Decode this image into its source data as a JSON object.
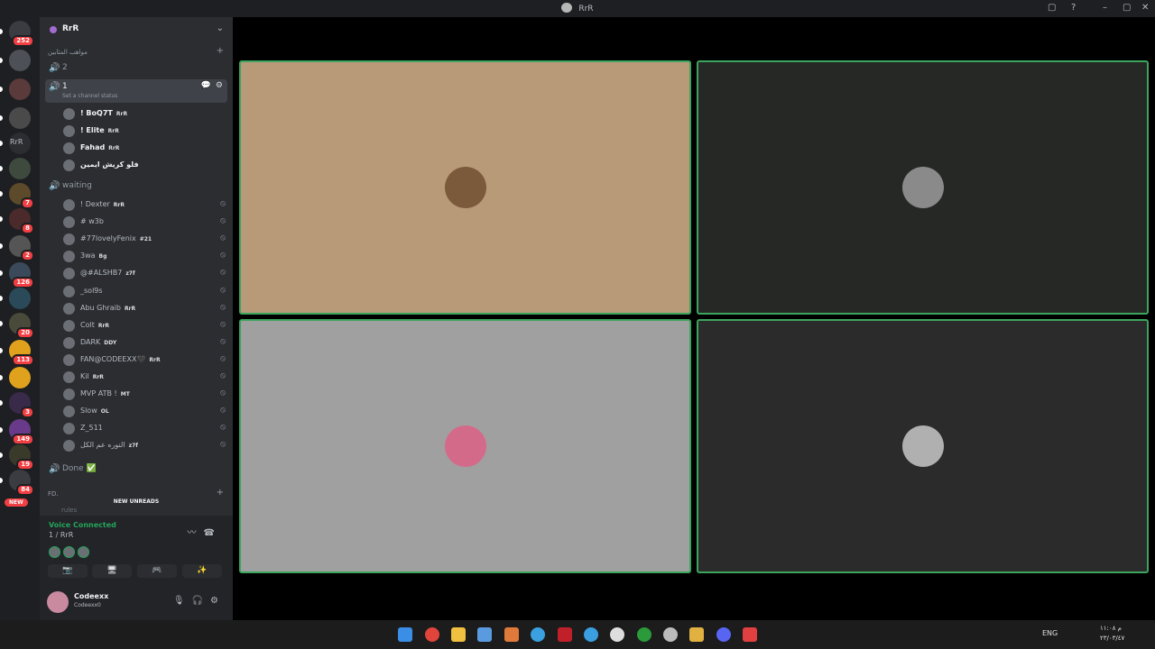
{
  "window": {
    "title": "RrR",
    "controls": [
      "▢",
      "?",
      "–",
      "▢",
      "✕"
    ]
  },
  "rail": {
    "servers": [
      {
        "badge": "252",
        "color": "#3a3c42"
      },
      {
        "badge": "",
        "color": "#4e5058"
      },
      {
        "badge": "",
        "color": "#5a3a3a"
      },
      {
        "badge": "",
        "color": "#4a4a4a"
      },
      {
        "badge": "",
        "color": "#2b2d31",
        "label": "RrR"
      },
      {
        "badge": "",
        "color": "#3e4a3e"
      },
      {
        "badge": "7",
        "color": "#5c4a2a"
      },
      {
        "badge": "8",
        "color": "#4a2a2a"
      },
      {
        "badge": "2",
        "color": "#555"
      },
      {
        "badge": "126",
        "color": "#3a4a5a"
      },
      {
        "badge": "",
        "color": "#2a4a5a"
      },
      {
        "badge": "20",
        "color": "#4a4a3a"
      },
      {
        "badge": "113",
        "color": "#e0a21c"
      },
      {
        "badge": "",
        "color": "#e0a21c"
      },
      {
        "badge": "3",
        "color": "#3a2a4a"
      },
      {
        "badge": "149",
        "color": "#6a3a8a"
      },
      {
        "badge": "19",
        "color": "#3a3a2a"
      },
      {
        "badge": "84",
        "color": "#3a3c42"
      }
    ],
    "new_label": "NEW"
  },
  "sidebar": {
    "guild_name": "RrR",
    "category1": "مواهب المثابين",
    "channel_2": "2",
    "channel_1": "1",
    "channel_1_status": "Set a channel status",
    "channel_1_tools": "💬 ⚙",
    "ch1_users": [
      {
        "name": "! BoQ7T",
        "tag": "RrR"
      },
      {
        "name": "! Elite",
        "tag": "RrR"
      },
      {
        "name": "Fahad",
        "tag": "RrR"
      },
      {
        "name": "فلو كريش ايمين",
        "tag": ""
      }
    ],
    "channel_waiting": "waiting",
    "waiting_users": [
      {
        "name": "! Dexter",
        "tag": "RrR"
      },
      {
        "name": "# w3b",
        "tag": ""
      },
      {
        "name": "#77lovelyFenix",
        "tag": "#21"
      },
      {
        "name": "3wa",
        "tag": "Bg"
      },
      {
        "name": "@#ALSHB7",
        "tag": "z7f"
      },
      {
        "name": "_sol9s",
        "tag": ""
      },
      {
        "name": "Abu Ghraib",
        "tag": "RrR"
      },
      {
        "name": "Colt",
        "tag": "RrR"
      },
      {
        "name": "DARK",
        "tag": "DDY"
      },
      {
        "name": "FAN@CODEEXX🖤",
        "tag": "RrR"
      },
      {
        "name": "Kil",
        "tag": "RrR"
      },
      {
        "name": "MVP ATB !",
        "tag": "MT"
      },
      {
        "name": "Slow",
        "tag": "OL"
      },
      {
        "name": "Z_511",
        "tag": ""
      },
      {
        "name": "النوره عم الكل",
        "tag": "z7f"
      }
    ],
    "channel_done": "Done ✅",
    "category2": "FD.",
    "partial_channel": "rules",
    "new_unreads": "NEW UNREADS"
  },
  "voice": {
    "status": "Voice Connected",
    "location": "1 / RrR",
    "buttons": [
      "📷",
      "🖥",
      "🎮",
      "✨"
    ]
  },
  "user": {
    "name": "Codeexx",
    "subtitle": "Codeexx0"
  },
  "stage": {
    "tiles": [
      {
        "bg": "#b99a78",
        "avatar": "#7a5a3a"
      },
      {
        "bg": "#262826",
        "avatar": "#8a8a8a"
      },
      {
        "bg": "#a0a0a0",
        "avatar": "#d46a8a"
      },
      {
        "bg": "#2b2b2b",
        "avatar": "#b0b0b0"
      }
    ]
  },
  "taskbar": {
    "lang": "ENG",
    "clock": "م ١١:٠٨",
    "date": "٢٣/٠٣/٤٧"
  }
}
